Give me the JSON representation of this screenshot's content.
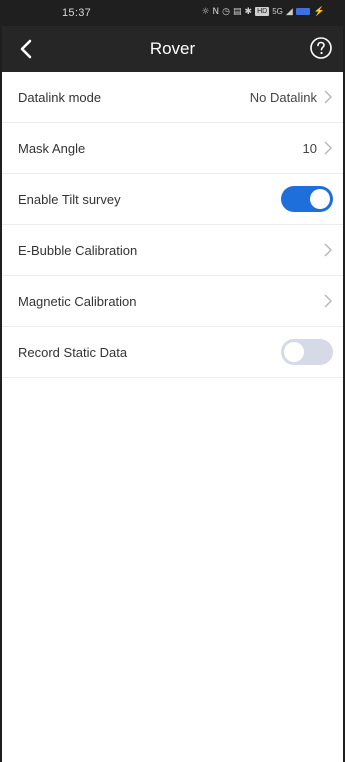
{
  "status_bar": {
    "time": "15:37",
    "icons": [
      "nfc-icon",
      "n-icon",
      "alarm-icon",
      "vibrate-icon",
      "bluetooth-icon",
      "hd-badge",
      "signal-1-icon",
      "signal-2-icon",
      "battery-icon"
    ],
    "hd_label": "HD",
    "signal_label": "5G"
  },
  "app_bar": {
    "title": "Rover",
    "back_icon": "back-arrow-icon",
    "help_icon": "help-circle-icon"
  },
  "settings": [
    {
      "label": "Datalink mode",
      "value": "No Datalink",
      "type": "nav"
    },
    {
      "label": "Mask Angle",
      "value": "10",
      "type": "nav"
    },
    {
      "label": "Enable Tilt survey",
      "type": "toggle",
      "checked": true
    },
    {
      "label": "E-Bubble Calibration",
      "value": "",
      "type": "nav"
    },
    {
      "label": "Magnetic Calibration",
      "value": "",
      "type": "nav"
    },
    {
      "label": "Record Static Data",
      "type": "toggle",
      "checked": false
    }
  ],
  "colors": {
    "accent": "#1e6fdc",
    "toggle_off": "#d6d9e6",
    "app_bar": "#262626",
    "status_bar": "#1f1f1f"
  }
}
